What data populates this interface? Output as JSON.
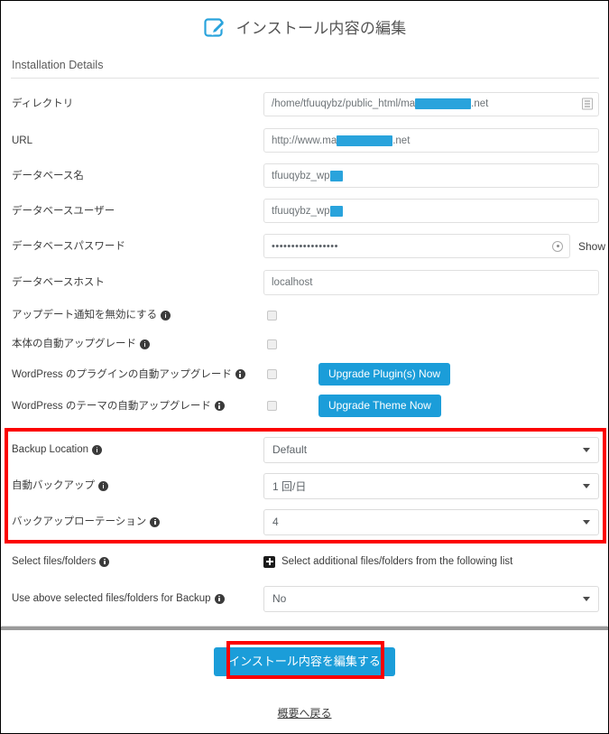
{
  "header": {
    "title": "インストール内容の編集",
    "icon": "edit-pencil-square-icon"
  },
  "section": {
    "title": "Installation Details"
  },
  "fields": {
    "directory": {
      "label": "ディレクトリ",
      "value_before": "/home/tfuuqybz/public_html/ma",
      "value_after": ".net",
      "addon_icon": "file-list-icon"
    },
    "url": {
      "label": "URL",
      "value_before": "http://www.ma",
      "value_after": ".net"
    },
    "db_name": {
      "label": "データベース名",
      "value_before": "tfuuqybz_wp",
      "value_after": ""
    },
    "db_user": {
      "label": "データベースユーザー",
      "value_before": "tfuuqybz_wp",
      "value_after": ""
    },
    "db_password": {
      "label": "データベースパスワード",
      "value": "•••••••••••••••••",
      "show_label": "Show",
      "eye_icon": "eye-reveal-icon"
    },
    "db_host": {
      "label": "データベースホスト",
      "value": "localhost"
    }
  },
  "toggles": [
    {
      "label": "アップデート通知を無効にする",
      "checked": false,
      "button": null
    },
    {
      "label": "本体の自動アップグレード",
      "checked": false,
      "button": null
    },
    {
      "label": "WordPress のプラグインの自動アップグレード",
      "checked": false,
      "button": "Upgrade Plugin(s) Now"
    },
    {
      "label": "WordPress のテーマの自動アップグレード",
      "checked": false,
      "button": "Upgrade Theme Now"
    }
  ],
  "backup": {
    "location": {
      "label": "Backup Location",
      "value": "Default"
    },
    "auto": {
      "label": "自動バックアップ",
      "value": "1 回/日"
    },
    "rotation": {
      "label": "バックアップローテーション",
      "value": "4"
    }
  },
  "files": {
    "select": {
      "label": "Select files/folders",
      "action_text": "Select additional files/folders from the following list",
      "icon": "plus-square-icon"
    },
    "use_selected": {
      "label": "Use above selected files/folders for Backup",
      "value": "No"
    }
  },
  "footer": {
    "submit_label": "インストール内容を編集する",
    "back_link": "概要へ戻る"
  },
  "colors": {
    "accent": "#1b9dd9",
    "highlight": "#fc0000",
    "redaction": "#29a3dc"
  }
}
